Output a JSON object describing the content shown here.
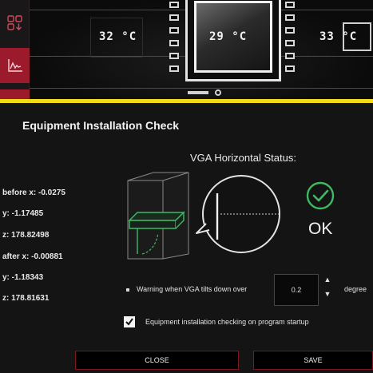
{
  "monitor": {
    "temps": [
      "32 °C",
      "29 °C",
      "33 °C"
    ]
  },
  "sidebar": {
    "items": [
      {
        "icon": "layout-grid-download-icon"
      },
      {
        "icon": "line-chart-icon",
        "active": true
      }
    ]
  },
  "dialog": {
    "title": "Equipment Installation Check",
    "vga_status_title": "VGA Horizontal Status:",
    "positions": [
      "before x: -0.0275",
      "y: -1.17485",
      "z: 178.82498",
      "after x: -0.00881",
      "y: -1.18343",
      "z: 178.81631"
    ],
    "status": "OK",
    "warning_label": "Warning when VGA tilts down over",
    "tilt_value": "0.2",
    "tilt_unit": "degree",
    "startup_check_label": "Equipment installation checking on program startup",
    "startup_checked": true,
    "close_label": "CLOSE",
    "save_label": "SAVE"
  },
  "colors": {
    "accent": "#9b1a2b",
    "warning_bar": "#f2dc15",
    "ok_green": "#3dbb62",
    "background": "#141414"
  }
}
